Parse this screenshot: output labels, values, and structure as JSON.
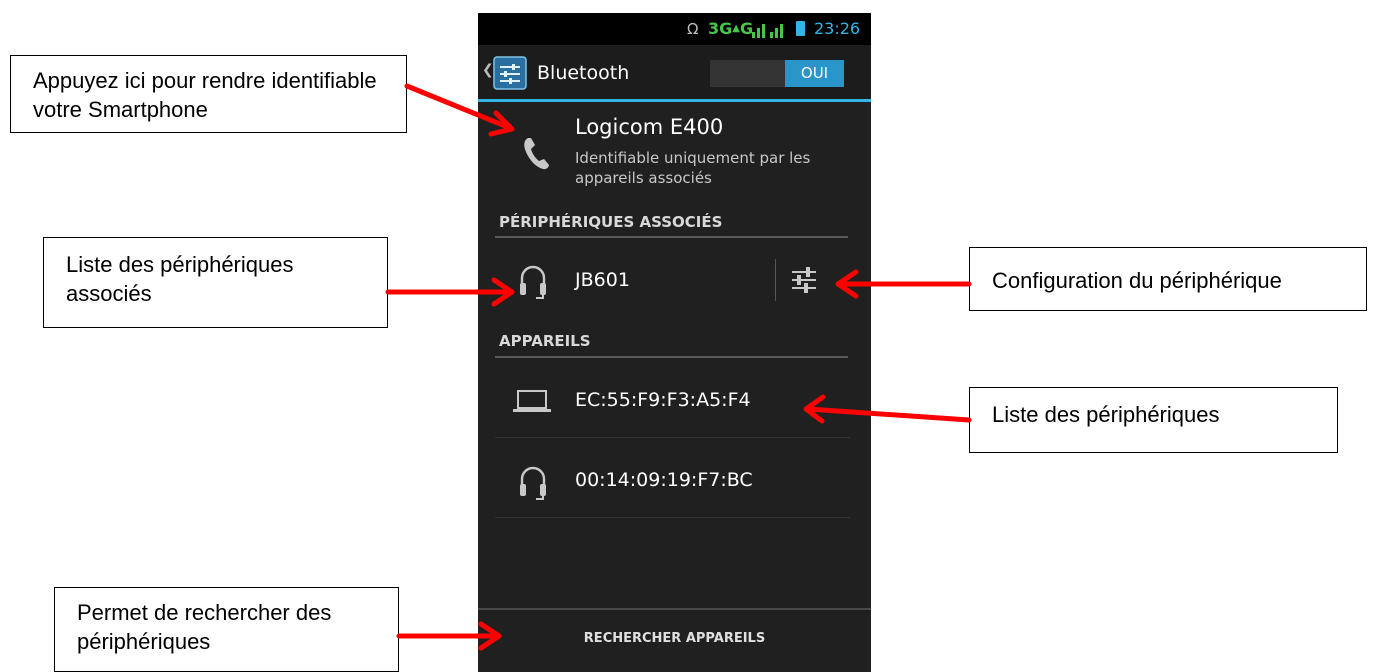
{
  "callouts": {
    "identify": "Appuyez ici pour rendre identifiable votre Smartphone",
    "paired_list": "Liste des périphériques associés",
    "config": "Configuration du périphérique",
    "device_list": "Liste des périphériques",
    "search": "Permet de rechercher des périphériques"
  },
  "statusbar": {
    "network": "3G",
    "network2": "G",
    "time": "23:26",
    "bluetooth_icon": "bluetooth-icon",
    "battery_icon": "battery-icon"
  },
  "actionbar": {
    "title": "Bluetooth",
    "toggle_on_label": "OUI",
    "back_icon": "chevron-left-icon",
    "app_icon": "settings-icon"
  },
  "device": {
    "name": "Logicom E400",
    "status": "Identifiable uniquement par les appareils associés",
    "icon": "phone-icon"
  },
  "paired": {
    "header": "PÉRIPHÉRIQUES ASSOCIÉS",
    "items": [
      {
        "name": "JB601",
        "icon": "headphones-icon",
        "action_icon": "settings-sliders-icon"
      }
    ]
  },
  "available": {
    "header": "APPAREILS",
    "items": [
      {
        "name": "EC:55:F9:F3:A5:F4",
        "icon": "laptop-icon"
      },
      {
        "name": "00:14:09:19:F7:BC",
        "icon": "headphones-icon"
      }
    ]
  },
  "scan_button": "RECHERCHER APPAREILS",
  "colors": {
    "accent": "#33b5e5",
    "annotation_arrow": "#ff0000",
    "network_green": "#49c54a",
    "screen_background": "#202020"
  }
}
